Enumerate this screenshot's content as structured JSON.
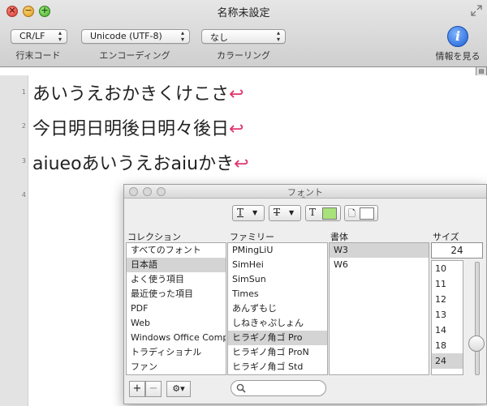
{
  "window": {
    "title": "名称未設定"
  },
  "toolbar": {
    "line_ending": {
      "value": "CR/LF",
      "label": "行末コード"
    },
    "encoding": {
      "value": "Unicode (UTF-8)",
      "label": "エンコーディング"
    },
    "coloring": {
      "value": "なし",
      "label": "カラーリング"
    },
    "info": {
      "label": "情報を見る"
    }
  },
  "editor": {
    "line_numbers": [
      "1",
      "2",
      "3",
      "4"
    ],
    "lines": [
      "あいうえおかきくけこさ",
      "今日明日明後日明々後日",
      "aiueoあいうえおaiuかき"
    ],
    "return_marker": "↩",
    "return_color": "#e0356b"
  },
  "font_panel": {
    "title": "フォント",
    "column_headers": {
      "collection": "コレクション",
      "family": "ファミリー",
      "typeface": "書体",
      "size": "サイズ"
    },
    "collections": [
      "すべてのフォント",
      "日本語",
      "よく使う項目",
      "最近使った項目",
      "PDF",
      "Web",
      "Windows Office Comp",
      "トラディショナル",
      "ファン"
    ],
    "selected_collection": "日本語",
    "families": [
      "PMingLiU",
      "SimHei",
      "SimSun",
      "Times",
      "あんずもじ",
      "しねきゃぷしょん",
      "ヒラギノ角ゴ Pro",
      "ヒラギノ角ゴ ProN",
      "ヒラギノ角ゴ Std"
    ],
    "selected_family": "ヒラギノ角ゴ Pro",
    "typefaces": [
      "W3",
      "W6"
    ],
    "selected_typeface": "W3",
    "size_value": "24",
    "sizes": [
      "10",
      "11",
      "12",
      "13",
      "14",
      "18",
      "24"
    ],
    "selected_size": "24",
    "text_color": "#a8e27a",
    "bottom_buttons": {
      "add": "+",
      "remove": "−"
    }
  }
}
